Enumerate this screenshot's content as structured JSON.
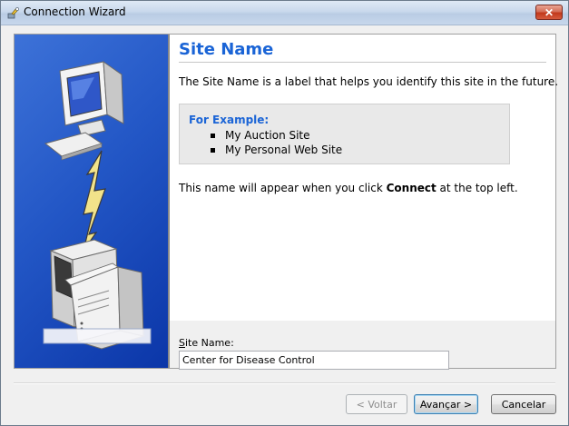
{
  "window": {
    "title": "Connection Wizard",
    "close_label": "✕"
  },
  "page": {
    "heading": "Site Name",
    "description": "The Site Name is a label that helps you identify this site in the future.",
    "example": {
      "title": "For Example:",
      "items": [
        "My Auction Site",
        "My Personal Web Site"
      ]
    },
    "note_before": "This name will appear when you click ",
    "note_bold": "Connect",
    "note_after": " at the top left."
  },
  "site_name": {
    "label": "Site Name:",
    "value": "Center for Disease Control",
    "accelerator": "S"
  },
  "buttons": {
    "back": "< Voltar",
    "next": "Avançar >",
    "cancel": "Cancelar"
  },
  "art_input": {
    "value": ""
  },
  "colors": {
    "accent": "#1a64d6",
    "banner": "#2357c6"
  }
}
